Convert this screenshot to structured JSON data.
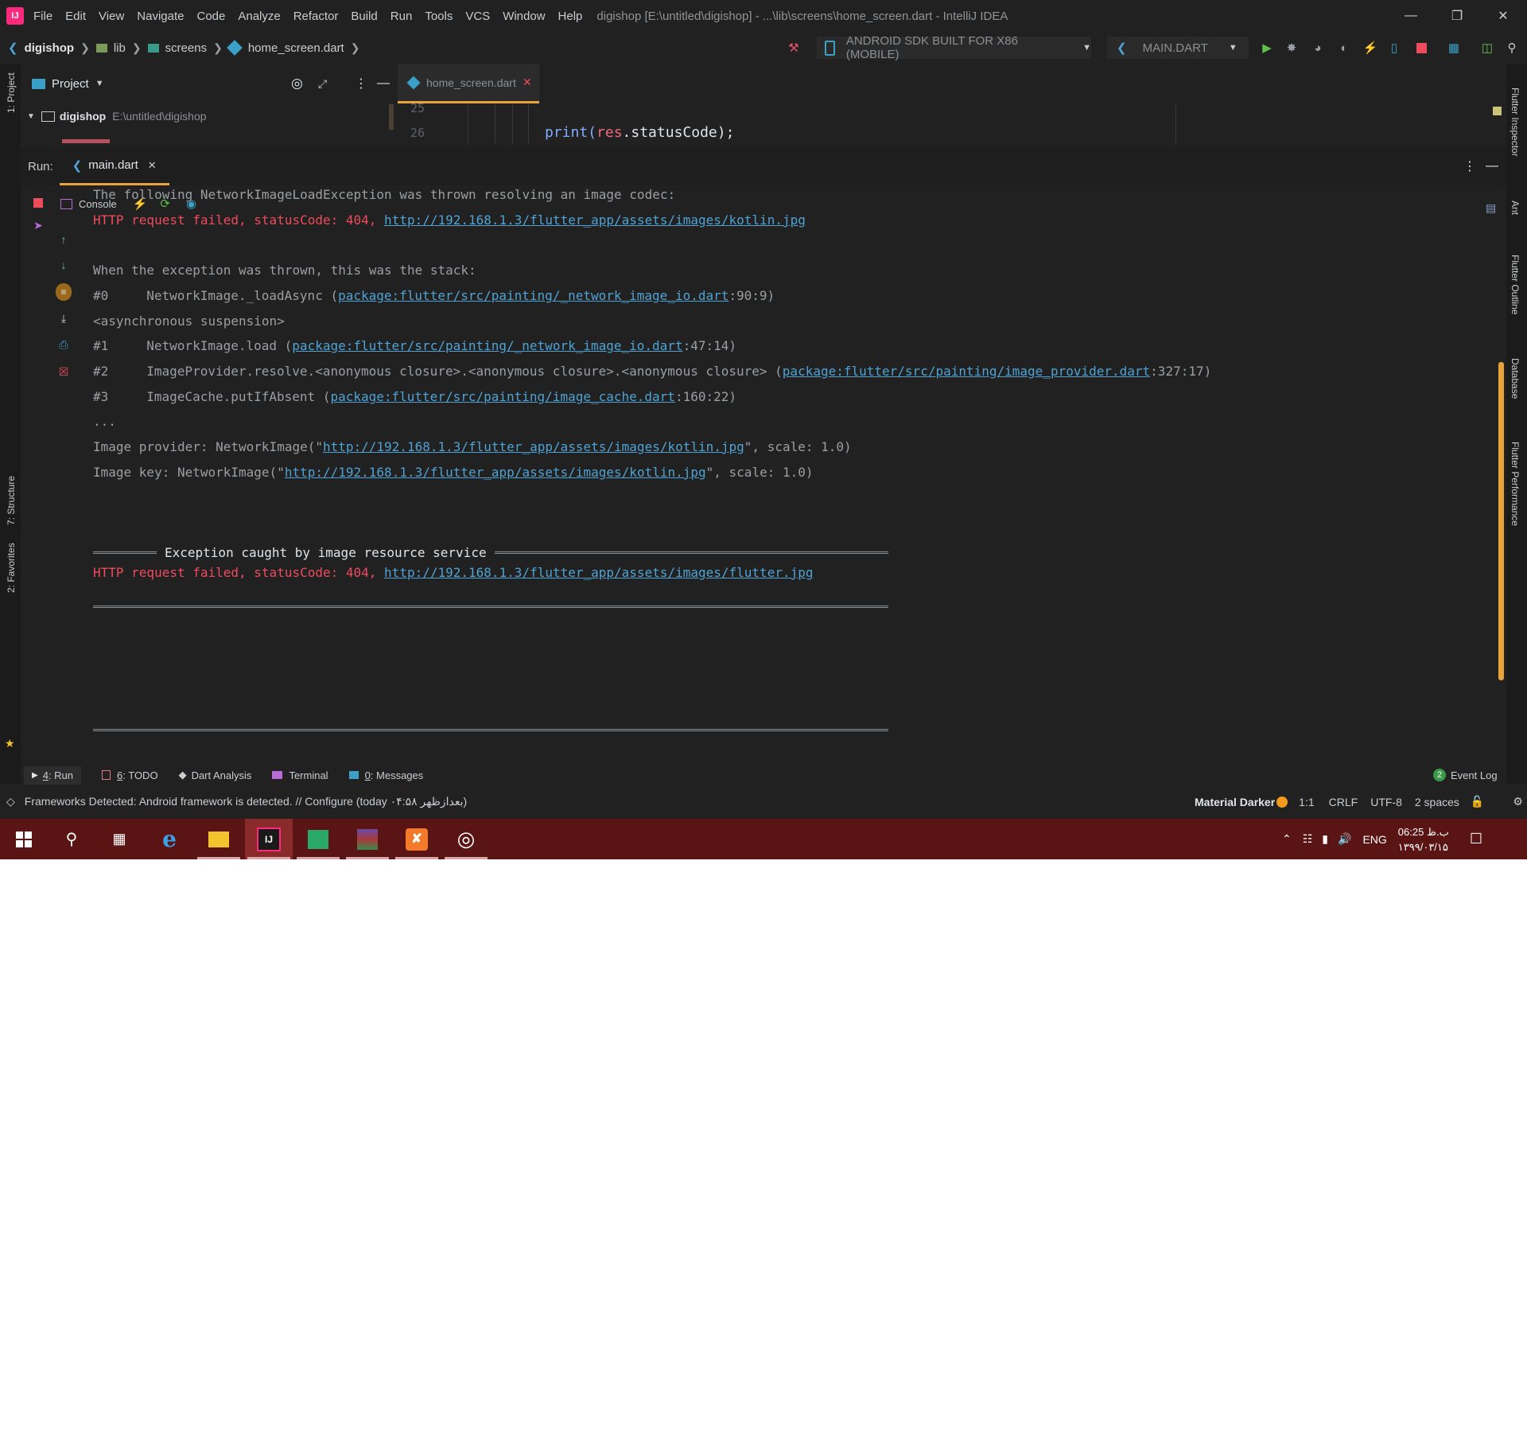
{
  "title_bar": {
    "menu": [
      "File",
      "Edit",
      "View",
      "Navigate",
      "Code",
      "Analyze",
      "Refactor",
      "Build",
      "Run",
      "Tools",
      "VCS",
      "Window",
      "Help"
    ],
    "window_title": "digishop [E:\\untitled\\digishop] - ...\\lib\\screens\\home_screen.dart - IntelliJ IDEA"
  },
  "breadcrumb": [
    "digishop",
    "lib",
    "screens",
    "home_screen.dart"
  ],
  "toolbar": {
    "device": "ANDROID SDK BUILT FOR X86 (MOBILE)",
    "run_config": "MAIN.DART"
  },
  "project_panel": {
    "header": "Project",
    "root_name": "digishop",
    "root_path": "E:\\untitled\\digishop"
  },
  "editor": {
    "tab": "home_screen.dart",
    "line_numbers": [
      "25",
      "26"
    ],
    "code_print": "print(",
    "code_res": "res",
    "code_rest": ".statusCode);"
  },
  "left_stripe": [
    "1: Project",
    "7: Structure",
    "2: Favorites"
  ],
  "right_stripe": [
    "Flutter Inspector",
    "Ant",
    "Flutter Outline",
    "Database",
    "Flutter Performance"
  ],
  "run_panel": {
    "label": "Run:",
    "tab": "main.dart",
    "console_label": "Console"
  },
  "console": {
    "l1": "The following NetworkImageLoadException was thrown resolving an image codec:",
    "l2_prefix": "HTTP request failed, statusCode: 404, ",
    "l2_link": "http://192.168.1.3/flutter_app/assets/images/kotlin.jpg",
    "l3": "When the exception was thrown, this was the stack:",
    "s0_num": "#0",
    "s0_text": "NetworkImage._loadAsync (",
    "s0_link": "package:flutter/src/painting/_network_image_io.dart",
    "s0_pos": ":90:9)",
    "async": "<asynchronous suspension>",
    "s1_num": "#1",
    "s1_text": "NetworkImage.load (",
    "s1_link": "package:flutter/src/painting/_network_image_io.dart",
    "s1_pos": ":47:14)",
    "s2_num": "#2",
    "s2_text": "ImageProvider.resolve.<anonymous closure>.<anonymous closure>.<anonymous closure> (",
    "s2_link": "package:flutter/src/painting/image_provider.dart",
    "s2_pos": ":327:17)",
    "s3_num": "#3",
    "s3_text": "ImageCache.putIfAbsent (",
    "s3_link": "package:flutter/src/painting/image_cache.dart",
    "s3_pos": ":160:22)",
    "ellipsis": "...",
    "prov_prefix": "Image provider: NetworkImage(\"",
    "prov_link": "http://192.168.1.3/flutter_app/assets/images/kotlin.jpg",
    "prov_suffix": "\", scale: 1.0)",
    "key_prefix": "Image key: NetworkImage(\"",
    "key_link": "http://192.168.1.3/flutter_app/assets/images/kotlin.jpg",
    "key_suffix": "\", scale: 1.0)",
    "exc_title": "Exception caught by image resource service",
    "l_last_prefix": "HTTP request failed, statusCode: 404, ",
    "l_last_link": "http://192.168.1.3/flutter_app/assets/images/flutter.jpg"
  },
  "bottom_tabs": [
    {
      "num": "4",
      "label": ": Run"
    },
    {
      "num": "6",
      "label": ": TODO"
    },
    {
      "num": "",
      "label": "Dart Analysis"
    },
    {
      "num": "",
      "label": "Terminal"
    },
    {
      "num": "0",
      "label": ": Messages"
    }
  ],
  "event_log": {
    "count": "2",
    "label": "Event Log"
  },
  "status_bar": {
    "message": "Frameworks Detected: Android framework is detected. // Configure (today ۰۴:۵۸ بعدازظهر)",
    "theme": "Material Darker",
    "position": "1:1",
    "line_sep": "CRLF",
    "encoding": "UTF-8",
    "indent": "2 spaces"
  },
  "taskbar": {
    "lang": "ENG",
    "time": "06:25 ب.ظ",
    "date": "۱۳۹۹/۰۳/۱۵"
  },
  "colors": {
    "accent": "#e8a33a",
    "error": "#ee4b5c",
    "link": "#4fa3d4",
    "taskbar": "#5b1414"
  }
}
